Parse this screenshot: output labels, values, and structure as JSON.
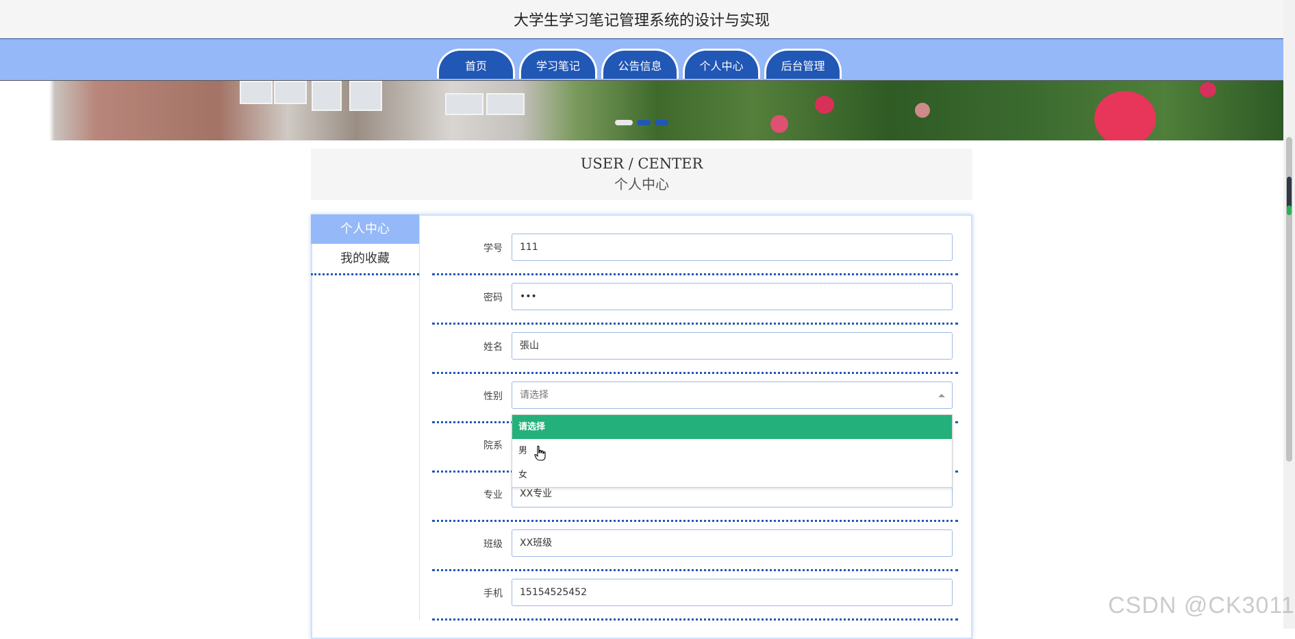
{
  "header": {
    "site_title": "大学生学习笔记管理系统的设计与实现"
  },
  "nav": {
    "tabs": [
      {
        "label": "首页"
      },
      {
        "label": "学习笔记"
      },
      {
        "label": "公告信息"
      },
      {
        "label": "个人中心"
      },
      {
        "label": "后台管理"
      }
    ]
  },
  "section": {
    "title_en": "USER / CENTER",
    "title_cn": "个人中心"
  },
  "sidebar": {
    "items": [
      {
        "label": "个人中心",
        "active": true
      },
      {
        "label": "我的收藏",
        "active": false
      }
    ]
  },
  "form": {
    "student_id": {
      "label": "学号",
      "value": "111"
    },
    "password": {
      "label": "密码",
      "value": "•••"
    },
    "name": {
      "label": "姓名",
      "value": "張山"
    },
    "gender": {
      "label": "性别",
      "placeholder": "请选择"
    },
    "department": {
      "label": "院系"
    },
    "major": {
      "label": "专业",
      "value": "XX专业"
    },
    "class": {
      "label": "班级",
      "value": "XX班级"
    },
    "phone": {
      "label": "手机",
      "value": "15154525452"
    }
  },
  "gender_dropdown": {
    "options": [
      {
        "label": "请选择",
        "selected": true
      },
      {
        "label": "男",
        "selected": false
      },
      {
        "label": "女",
        "selected": false
      }
    ]
  },
  "watermark": "CSDN @CK3011",
  "colors": {
    "nav_bg": "#95b8f8",
    "tab_bg": "#2157b5",
    "selected_option": "#24b07a",
    "divider": "#2157b5"
  }
}
